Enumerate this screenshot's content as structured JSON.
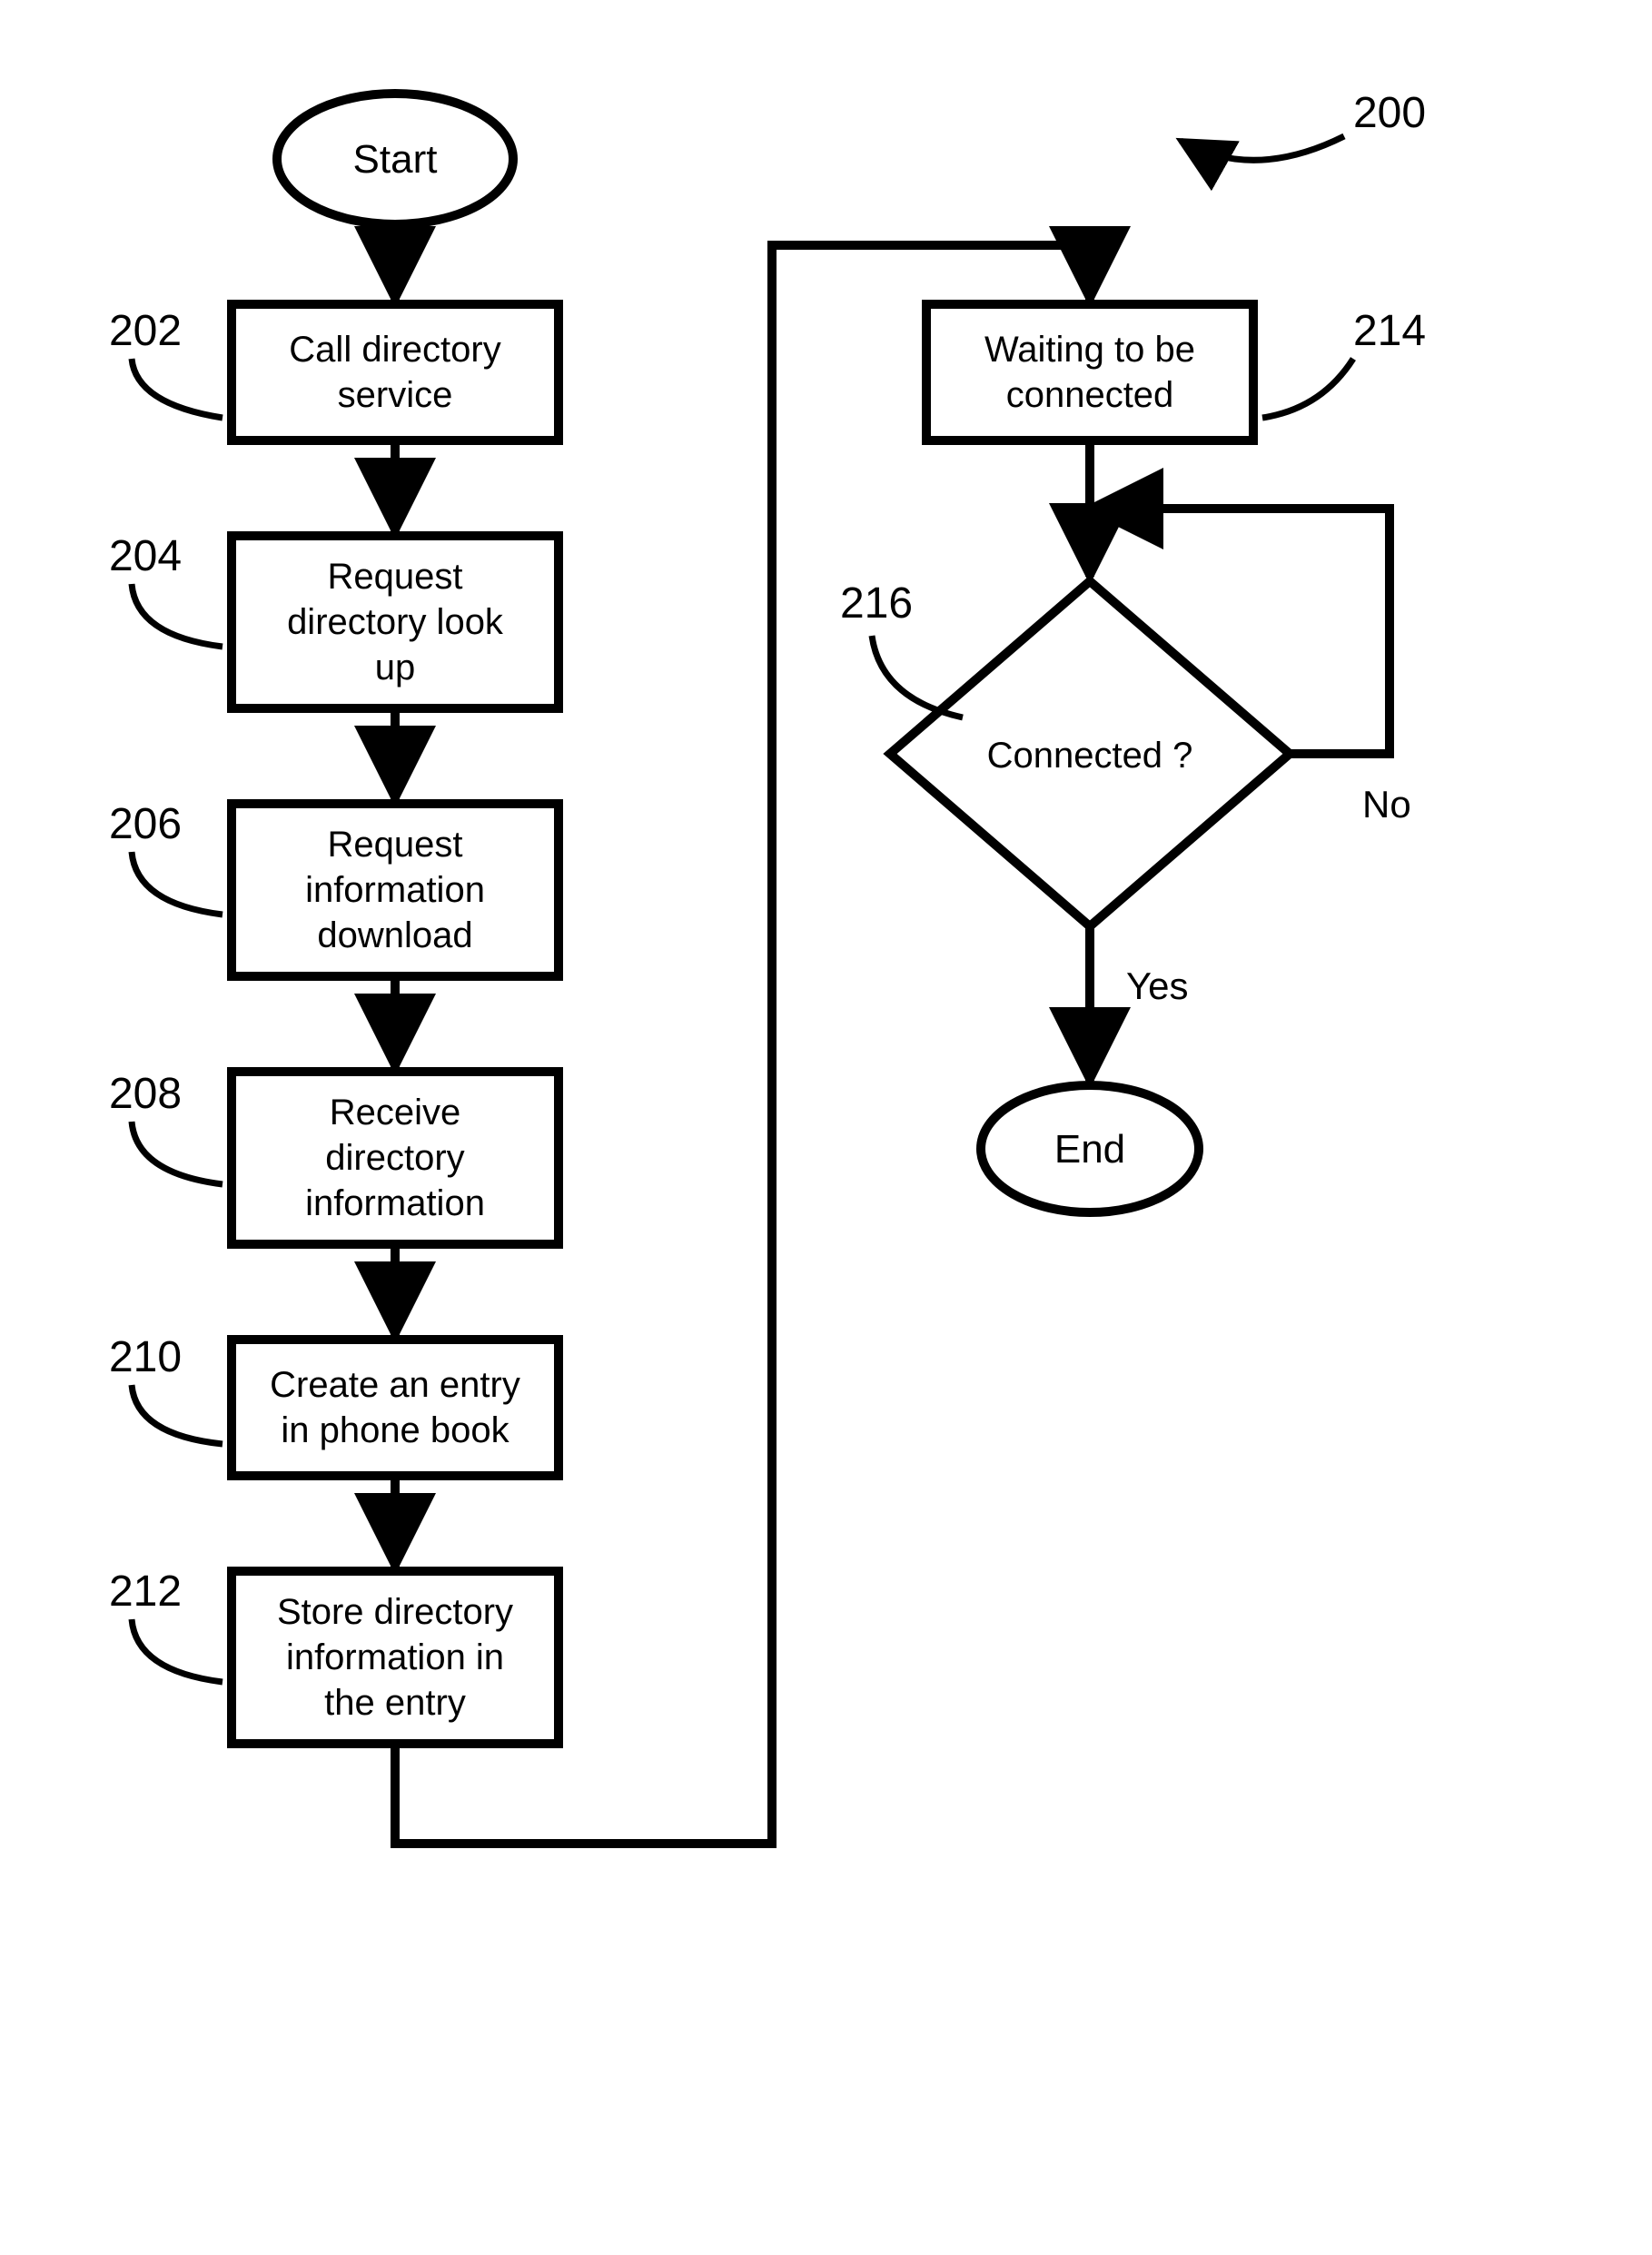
{
  "diagram_id": "200",
  "nodes": {
    "start": {
      "label": "Start"
    },
    "end": {
      "label": "End"
    },
    "n202": {
      "ref": "202",
      "line1": "Call directory",
      "line2": "service"
    },
    "n204": {
      "ref": "204",
      "line1": "Request",
      "line2": "directory look",
      "line3": "up"
    },
    "n206": {
      "ref": "206",
      "line1": "Request",
      "line2": "information",
      "line3": "download"
    },
    "n208": {
      "ref": "208",
      "line1": "Receive",
      "line2": "directory",
      "line3": "information"
    },
    "n210": {
      "ref": "210",
      "line1": "Create an entry",
      "line2": "in phone book"
    },
    "n212": {
      "ref": "212",
      "line1": "Store directory",
      "line2": "information in",
      "line3": "the entry"
    },
    "n214": {
      "ref": "214",
      "line1": "Waiting to be",
      "line2": "connected"
    },
    "n216": {
      "ref": "216",
      "text": "Connected ?"
    }
  },
  "edges": {
    "yes": "Yes",
    "no": "No"
  }
}
